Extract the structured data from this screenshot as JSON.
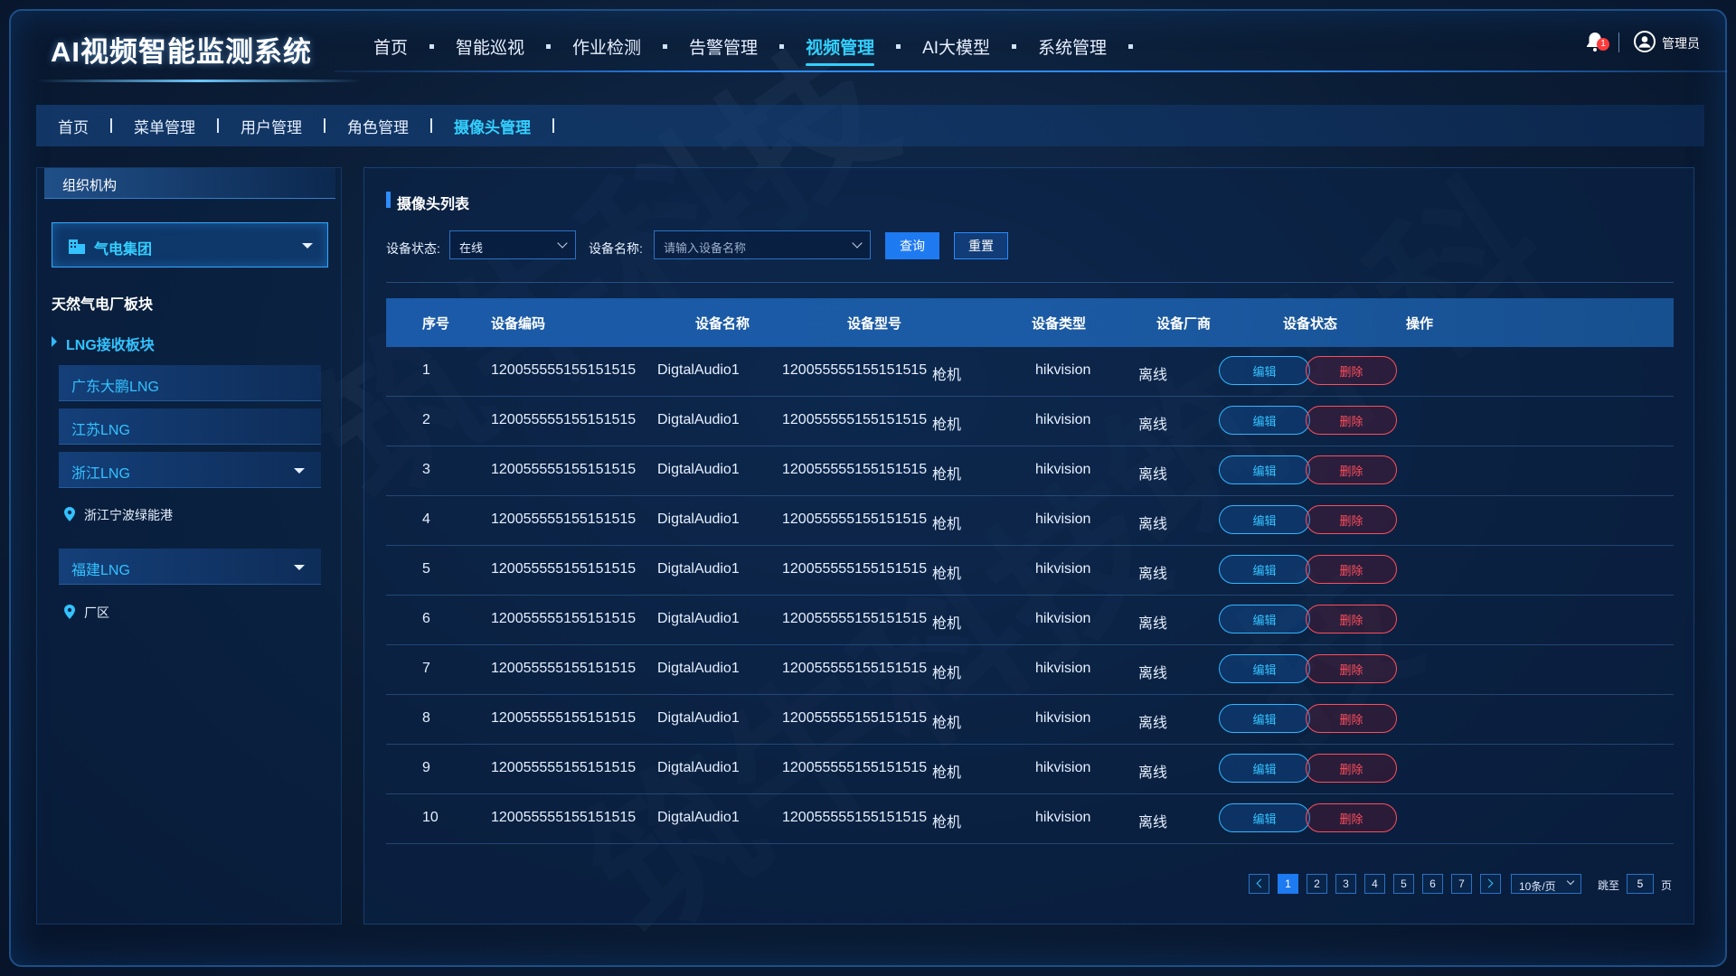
{
  "header": {
    "app_title": "AI视频智能监测系统",
    "nav": [
      {
        "label": "首页",
        "active": false
      },
      {
        "label": "智能巡视",
        "active": false
      },
      {
        "label": "作业检测",
        "active": false
      },
      {
        "label": "告警管理",
        "active": false
      },
      {
        "label": "视频管理",
        "active": true
      },
      {
        "label": "AI大模型",
        "active": false
      },
      {
        "label": "系统管理",
        "active": false
      }
    ],
    "notification_count": "1",
    "user_name": "管理员"
  },
  "breadcrumb": [
    {
      "label": "首页",
      "active": false
    },
    {
      "label": "菜单管理",
      "active": false
    },
    {
      "label": "用户管理",
      "active": false
    },
    {
      "label": "角色管理",
      "active": false
    },
    {
      "label": "摄像头管理",
      "active": true
    }
  ],
  "sidebar": {
    "title": "组织机构",
    "org_select": "气电集团",
    "section_label": "天然气电厂板块",
    "group_label": "LNG接收板块",
    "items": [
      {
        "label": "广东大鹏LNG"
      },
      {
        "label": "江苏LNG"
      },
      {
        "label": "浙江LNG"
      },
      {
        "label": "福建LNG"
      }
    ],
    "leaf_zhejiang": "浙江宁波绿能港",
    "leaf_fujian": "厂区"
  },
  "main": {
    "title": "摄像头列表",
    "filters": {
      "status_label": "设备状态:",
      "status_value": "在线",
      "name_label": "设备名称:",
      "name_placeholder": "请输入设备名称",
      "query_label": "查询",
      "reset_label": "重置"
    },
    "columns": [
      "序号",
      "设备编码",
      "设备名称",
      "设备型号",
      "设备类型",
      "设备厂商",
      "设备状态",
      "操作"
    ],
    "rows": [
      {
        "no": "1",
        "code": "120055555155151515",
        "name": "DigtalAudio1",
        "model": "120055555155151515",
        "type": "枪机",
        "vendor": "hikvision",
        "status": "离线"
      },
      {
        "no": "2",
        "code": "120055555155151515",
        "name": "DigtalAudio1",
        "model": "120055555155151515",
        "type": "枪机",
        "vendor": "hikvision",
        "status": "离线"
      },
      {
        "no": "3",
        "code": "120055555155151515",
        "name": "DigtalAudio1",
        "model": "120055555155151515",
        "type": "枪机",
        "vendor": "hikvision",
        "status": "离线"
      },
      {
        "no": "4",
        "code": "120055555155151515",
        "name": "DigtalAudio1",
        "model": "120055555155151515",
        "type": "枪机",
        "vendor": "hikvision",
        "status": "离线"
      },
      {
        "no": "5",
        "code": "120055555155151515",
        "name": "DigtalAudio1",
        "model": "120055555155151515",
        "type": "枪机",
        "vendor": "hikvision",
        "status": "离线"
      },
      {
        "no": "6",
        "code": "120055555155151515",
        "name": "DigtalAudio1",
        "model": "120055555155151515",
        "type": "枪机",
        "vendor": "hikvision",
        "status": "离线"
      },
      {
        "no": "7",
        "code": "120055555155151515",
        "name": "DigtalAudio1",
        "model": "120055555155151515",
        "type": "枪机",
        "vendor": "hikvision",
        "status": "离线"
      },
      {
        "no": "8",
        "code": "120055555155151515",
        "name": "DigtalAudio1",
        "model": "120055555155151515",
        "type": "枪机",
        "vendor": "hikvision",
        "status": "离线"
      },
      {
        "no": "9",
        "code": "120055555155151515",
        "name": "DigtalAudio1",
        "model": "120055555155151515",
        "type": "枪机",
        "vendor": "hikvision",
        "status": "离线"
      },
      {
        "no": "10",
        "code": "120055555155151515",
        "name": "DigtalAudio1",
        "model": "120055555155151515",
        "type": "枪机",
        "vendor": "hikvision",
        "status": "离线"
      }
    ],
    "edit_label": "编辑",
    "delete_label": "删除",
    "pagination": {
      "pages": [
        "1",
        "2",
        "3",
        "4",
        "5",
        "6",
        "7"
      ],
      "current": "1",
      "page_size": "10条/页",
      "jump_prefix": "跳至",
      "jump_value": "5",
      "jump_suffix": "页"
    }
  },
  "watermark": "筑牛科技",
  "colors": {
    "accent": "#33d0ff",
    "primary_button": "#1e7af0",
    "danger": "#ff4d5a",
    "table_header": "#1a5aa8",
    "background": "#0b1d36"
  }
}
